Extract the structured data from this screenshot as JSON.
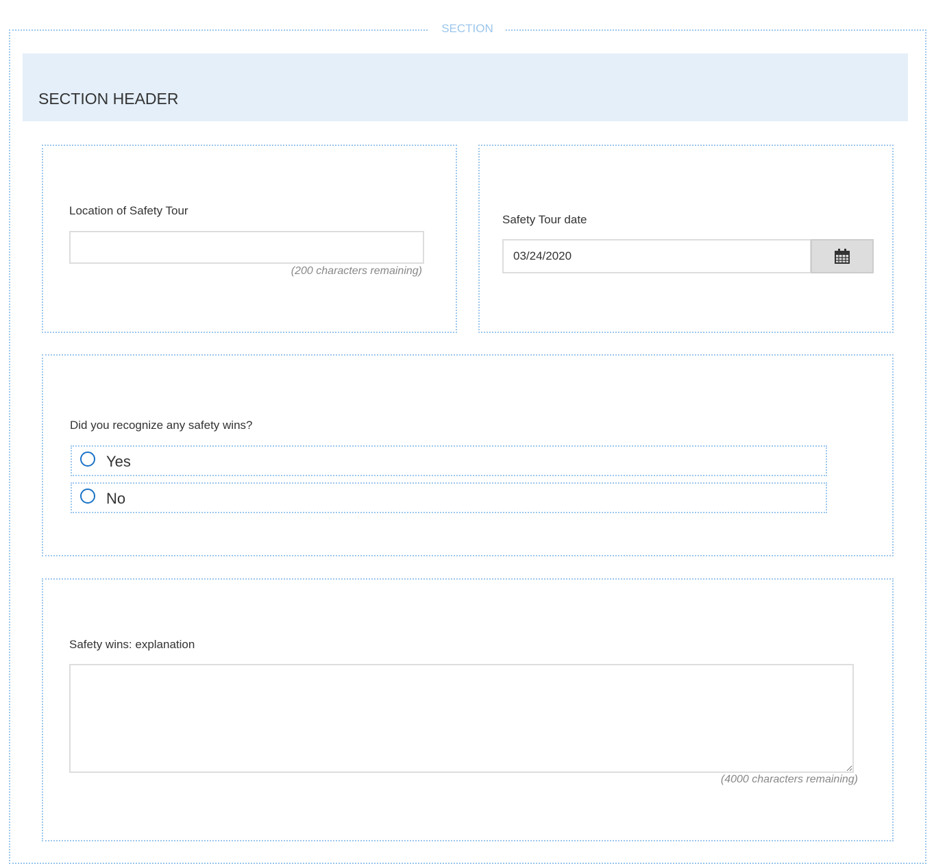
{
  "section": {
    "legend": "SECTION",
    "header": "SECTION HEADER"
  },
  "location": {
    "label": "Location of Safety Tour",
    "value": "",
    "hint": "(200 characters remaining)"
  },
  "date": {
    "label": "Safety Tour date",
    "value": "03/24/2020"
  },
  "wins": {
    "question": "Did you recognize any safety wins?",
    "options": [
      {
        "label": "Yes",
        "selected": false
      },
      {
        "label": "No",
        "selected": false
      }
    ]
  },
  "explanation": {
    "label": "Safety wins: explanation",
    "value": "",
    "hint": "(4000 characters remaining)"
  }
}
